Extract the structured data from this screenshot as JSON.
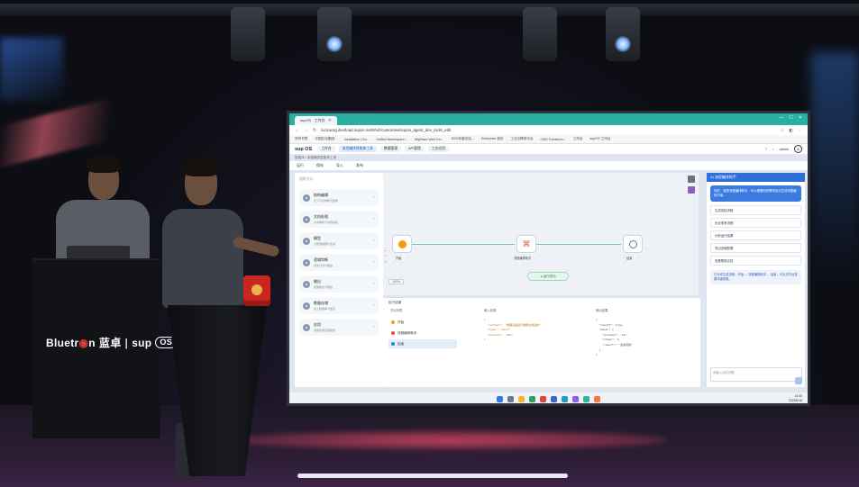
{
  "stage": {
    "podium_brand": "Bluetr",
    "podium_brand_rest": "n",
    "podium_brand_cn": "蓝卓",
    "podium_sup": "sup",
    "podium_os": "OS"
  },
  "screen": {
    "tab_title": "supOS · 工作台",
    "url": "lucicaorg.dev/load.supos.net/#/viz/customise/supos_agent_dev_tools_edit",
    "bookmarks": [
      "所有书签",
      "中国石化集团...",
      "Installation | Sa...",
      "Unified Namespace...",
      "MiyBlaze Web Too...",
      "2025年度总结...",
      "Enterprise 首页",
      "工业互联网平台",
      "CMS Transform...",
      "工作台",
      "supOS 工作台"
    ],
    "app_logo": "sup OS",
    "app_tabs": [
      "工作台",
      "流程编排智能体工具",
      "数据管理",
      "API管理",
      "工业应用"
    ],
    "user": "admin",
    "breadcrumb": "智能体 / 流程编排智能体工具",
    "toolbar": [
      "运行",
      "保存",
      "导入",
      "发布"
    ],
    "left_search": "搜索节点",
    "left_items": [
      {
        "title": "结构编辑",
        "sub": "定义节点参数与结构"
      },
      {
        "title": "文档处理",
        "sub": "文本解析与内容提取"
      },
      {
        "title": "模型",
        "sub": "大模型推理与生成"
      },
      {
        "title": "逻辑判断",
        "sub": "条件分支与路由"
      },
      {
        "title": "输出",
        "sub": "结果输出与推送"
      },
      {
        "title": "数据存储",
        "sub": "写入数据库与缓存"
      },
      {
        "title": "应用",
        "sub": "调用外部应用服务"
      }
    ],
    "nodes": [
      {
        "label": "开始"
      },
      {
        "label": "流程编排助手"
      },
      {
        "label": "结束"
      }
    ],
    "status": "运行成功",
    "zoom": "100%",
    "bottom_title": "执行结果",
    "bottom_cols": [
      "节点列表",
      "输入参数",
      "输出结果"
    ],
    "bottom_rows": [
      {
        "label": "开始",
        "color": "#f39c12"
      },
      {
        "label": "流程编排助手",
        "color": "#e74c3c"
      },
      {
        "label": "结束",
        "color": "#2e86de"
      }
    ],
    "input_code": "{\n  \"content\": \"根据设备运行数据生成巡检\",\n  \"type\": \"text\",\n  \"session\": \"a01\"\n}",
    "output_code": "{\n  \"result\": true,\n  \"data\": {\n    \"process\": \"ok\",\n    \"steps\": 3,\n    \"report\": \"生成完成\"\n  }\n}",
    "chat_title": "AI 流程编排助手",
    "chat_bubble": "你好，我是流程编排助手，可以根据你的需求自动生成流程编排方案。",
    "chat_options": [
      "生成巡检流程",
      "优化现有流程",
      "分析运行结果",
      "导出流程配置",
      "查看帮助文档"
    ],
    "chat_note": "已为你生成流程：开始 → 流程编排助手 → 结束，可点击节点查看详细参数。",
    "chat_input": "请输入你的问题",
    "clock_time": "14:30",
    "clock_date": "2025/6/18"
  }
}
